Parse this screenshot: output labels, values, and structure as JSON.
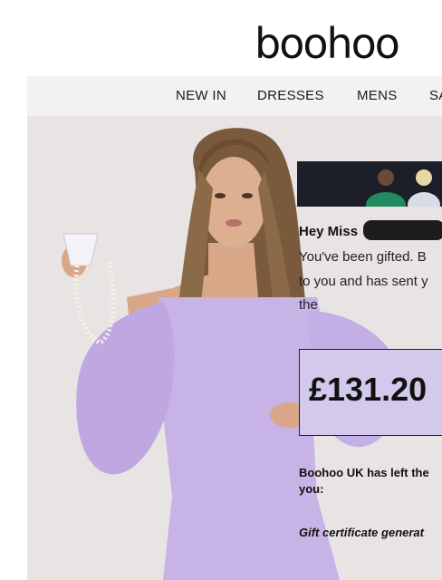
{
  "brand": {
    "logo_text": "boohoo"
  },
  "nav": {
    "items": [
      {
        "label": "NEW IN"
      },
      {
        "label": "DRESSES"
      },
      {
        "label": "MENS"
      },
      {
        "label": "SA"
      }
    ]
  },
  "email": {
    "greeting": "Hey Miss",
    "body_lines": [
      "You've been gifted. B",
      "to you and has sent y",
      "the"
    ],
    "amount": "£131.20",
    "sender_note_line1": "Boohoo UK has left the",
    "sender_note_line2": "you:",
    "certificate_text": "Gift certificate generat"
  },
  "colors": {
    "dress": "#c7b3e6",
    "nav_bg": "#f2f2f2",
    "amount_box": "#d2c9ec"
  }
}
